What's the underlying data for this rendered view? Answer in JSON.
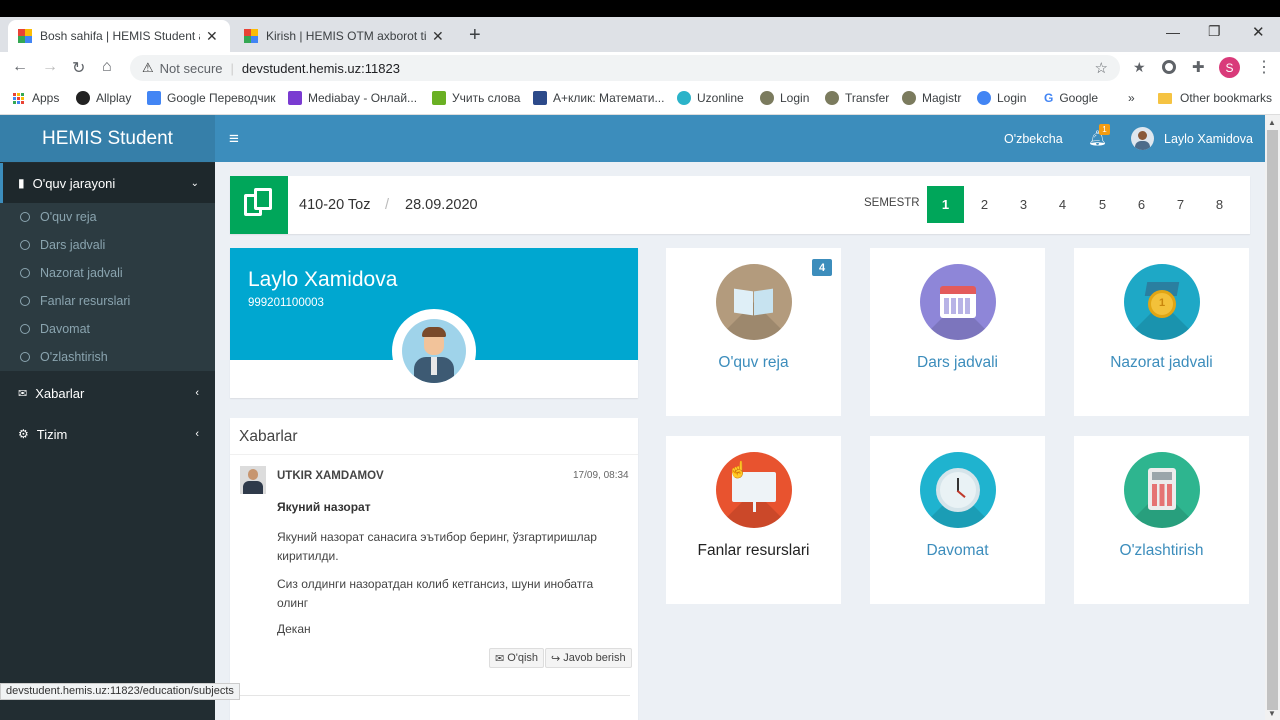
{
  "browser": {
    "tabs": [
      {
        "title": "Bosh sahifa | HEMIS Student axborot"
      },
      {
        "title": "Kirish | HEMIS OTM axborot tizimi"
      }
    ],
    "security_label": "Not secure",
    "url": "devstudent.hemis.uz:11823",
    "bookmarks": [
      "Apps",
      "Allplay",
      "Google Переводчик",
      "Mediabay - Онлай...",
      "Учить слова",
      "A+клик: Математи...",
      "Uzonline",
      "Login",
      "Transfer",
      "Magistr",
      "Login",
      "Google"
    ],
    "other_bookmarks": "Other bookmarks",
    "profile_initial": "S",
    "status_url": "devstudent.hemis.uz:11823/education/subjects"
  },
  "app": {
    "logo": "HEMIS Student",
    "language": "O'zbekcha",
    "notification_count": "1",
    "user_name": "Laylo Xamidova"
  },
  "sidebar": {
    "section": "O'quv jarayoni",
    "sub_items": [
      "O'quv reja",
      "Dars jadvali",
      "Nazorat jadvali",
      "Fanlar resurslari",
      "Davomat",
      "O'zlashtirish"
    ],
    "items": [
      "Xabarlar",
      "Tizim"
    ]
  },
  "info_bar": {
    "group": "410-20 Toz",
    "separator": "/",
    "date": "28.09.2020",
    "semester_label": "SEMESTR",
    "semesters": [
      "1",
      "2",
      "3",
      "4",
      "5",
      "6",
      "7",
      "8"
    ],
    "active_semester": "1"
  },
  "profile": {
    "name": "Laylo Xamidova",
    "id": "999201100003"
  },
  "news": {
    "title": "Xabarlar",
    "author": "UTKIR XAMDAMOV",
    "time": "17/09, 08:34",
    "subject": "Якуний назорат",
    "body1": "Якуний назорат санасига эътибор беринг, ўзгартиришлар киритилди.",
    "body2": "Сиз олдинги назоратдан колиб кетгансиз, шуни инобатга олинг",
    "signature": "Декан",
    "read_btn": "O'qish",
    "reply_btn": "Javob berish"
  },
  "cards": [
    {
      "label": "O'quv reja",
      "badge": "4",
      "color": "#b39b7d",
      "icon": "open-book-icon"
    },
    {
      "label": "Dars jadvali",
      "color": "#8e86d8",
      "icon": "calendar-icon"
    },
    {
      "label": "Nazorat jadvali",
      "color": "#1ea8c6",
      "icon": "medal-icon"
    },
    {
      "label": "Fanlar resurslari",
      "color": "#e8532f",
      "icon": "presentation-board-icon"
    },
    {
      "label": "Davomat",
      "color": "#1fb3cf",
      "icon": "clock-icon"
    },
    {
      "label": "O'zlashtirish",
      "color": "#2eb58f",
      "icon": "calculator-icon"
    }
  ]
}
